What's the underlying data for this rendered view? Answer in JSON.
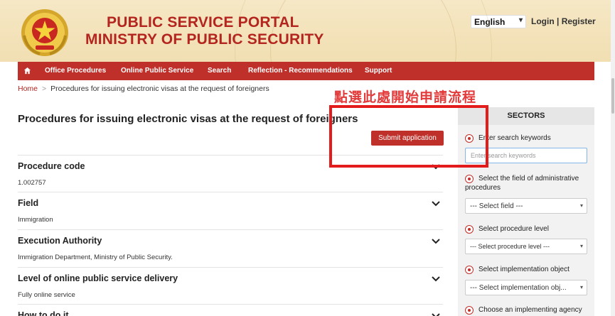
{
  "header": {
    "portal_title": "PUBLIC SERVICE PORTAL",
    "ministry_title": "MINISTRY OF PUBLIC SECURITY",
    "language": "English",
    "login": "Login",
    "separator": "|",
    "register": "Register"
  },
  "nav": {
    "items": [
      {
        "label": "Office Procedures"
      },
      {
        "label": "Online Public Service"
      },
      {
        "label": "Search"
      },
      {
        "label": "Reflection - Recommendations"
      },
      {
        "label": "Support"
      }
    ]
  },
  "breadcrumb": {
    "home": "Home",
    "separator": ">",
    "current": "Procedures for issuing electronic visas at the request of foreigners"
  },
  "annotation": {
    "text": "點選此處開始申請流程"
  },
  "main": {
    "title": "Procedures for issuing electronic visas at the request of foreigners",
    "submit_label": "Submit application",
    "sections": [
      {
        "title": "Procedure code",
        "value": "1.002757"
      },
      {
        "title": "Field",
        "value": "Immigration"
      },
      {
        "title": "Execution Authority",
        "value": "Immigration Department, Ministry of Public Security."
      },
      {
        "title": "Level of online public service delivery",
        "value": "Fully online service"
      },
      {
        "title": "How to do it",
        "value": ""
      }
    ]
  },
  "sidebar": {
    "header": "SECTORS",
    "search_label": "Enter search keywords",
    "search_placeholder": "Enter search keywords",
    "field_label": "Select the field of administrative procedures",
    "field_select": "--- Select field ---",
    "level_label": "Select procedure level",
    "level_select": "--- Select procedure level ---",
    "object_label": "Select implementation object",
    "object_select": "--- Select implementation obj...",
    "agency_label": "Choose an implementing agency"
  },
  "colors": {
    "brand_red": "#c0302a",
    "header_bg": "#f3e2b9",
    "annotation_red": "#e31b1b"
  }
}
